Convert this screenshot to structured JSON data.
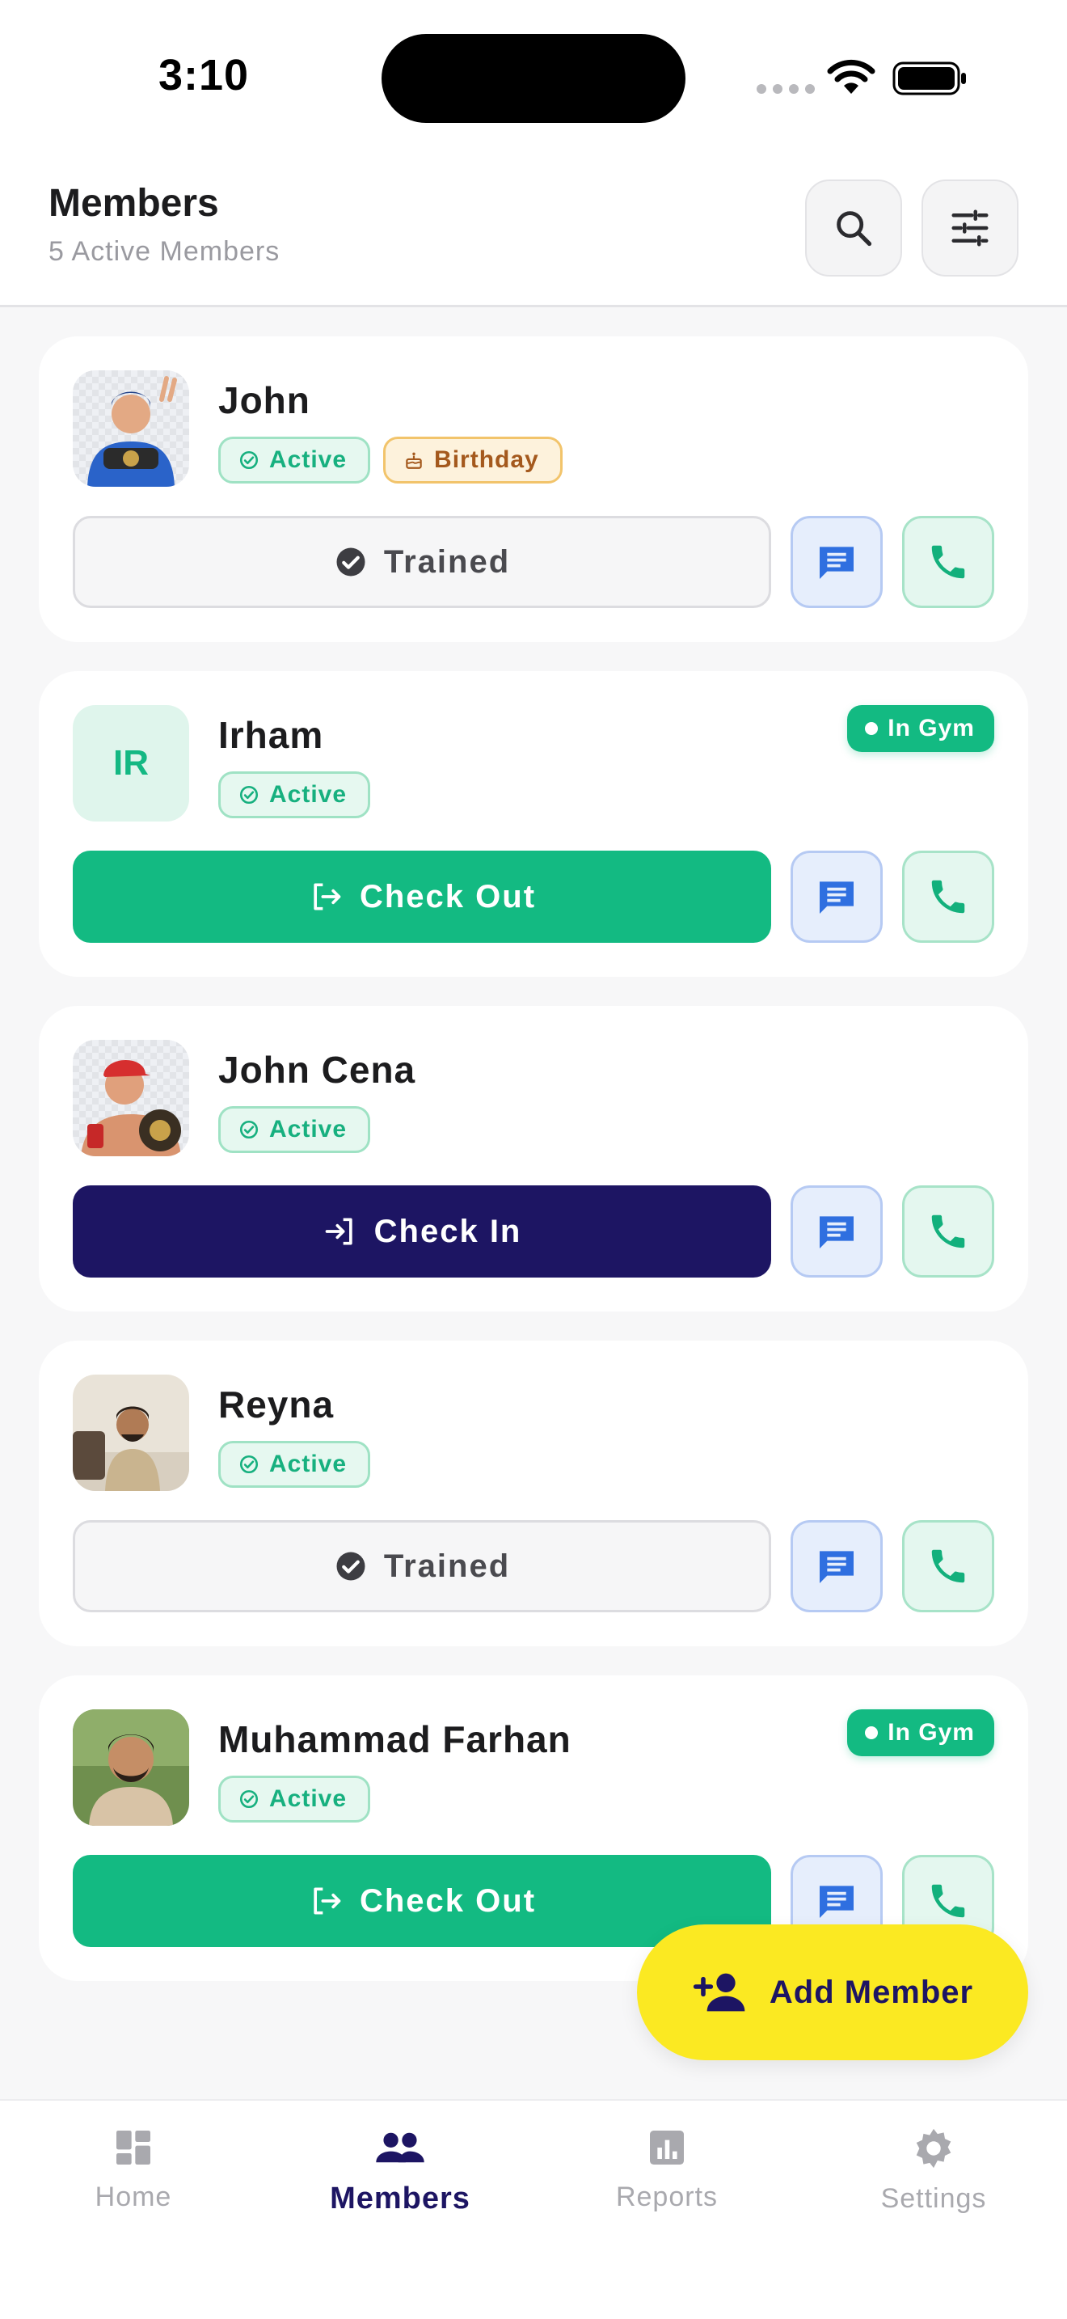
{
  "status_bar": {
    "time": "3:10"
  },
  "header": {
    "title": "Members",
    "subtitle": "5 Active Members"
  },
  "members": [
    {
      "name": "John",
      "status": "Active",
      "birthday_label": "Birthday",
      "action": "Trained",
      "avatar": "photo"
    },
    {
      "name": "Irham",
      "initials": "IR",
      "status": "Active",
      "in_gym": "In Gym",
      "action": "Check Out",
      "avatar": "initials"
    },
    {
      "name": "John Cena",
      "status": "Active",
      "action": "Check In",
      "avatar": "photo"
    },
    {
      "name": "Reyna",
      "status": "Active",
      "action": "Trained",
      "avatar": "photo"
    },
    {
      "name": "Muhammad Farhan",
      "status": "Active",
      "in_gym": "In Gym",
      "action": "Check Out",
      "avatar": "photo"
    }
  ],
  "fab": {
    "label": "Add Member"
  },
  "nav": [
    {
      "label": "Home",
      "icon": "dashboard-icon",
      "active": false
    },
    {
      "label": "Members",
      "icon": "people-icon",
      "active": true
    },
    {
      "label": "Reports",
      "icon": "chart-icon",
      "active": false
    },
    {
      "label": "Settings",
      "icon": "gear-icon",
      "active": false
    }
  ],
  "colors": {
    "primary_green": "#13ba82",
    "navy": "#1d1563",
    "fab_yellow": "#fbe922",
    "message_blue": "#3b82f6"
  }
}
